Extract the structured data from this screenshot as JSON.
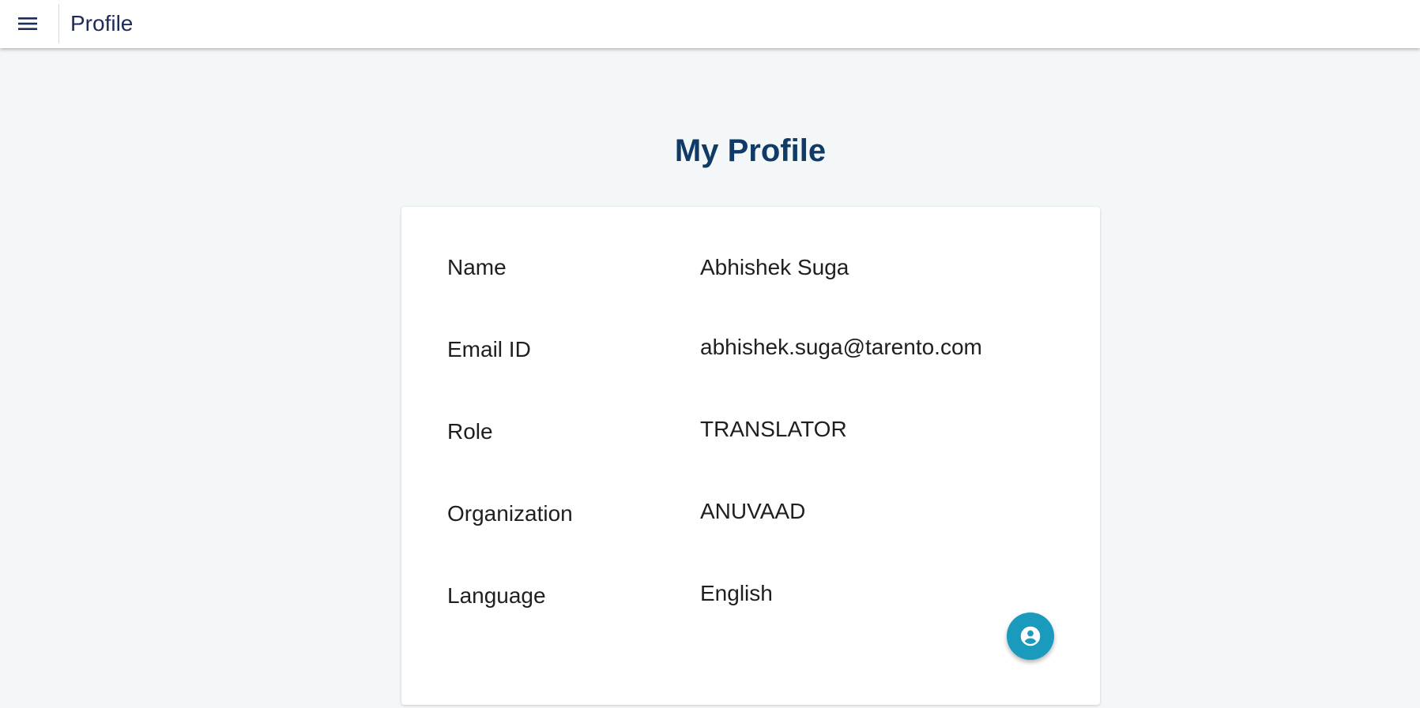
{
  "appbar": {
    "title": "Profile",
    "menu_icon": "menu-icon"
  },
  "page": {
    "title": "My Profile"
  },
  "profile": {
    "fields": [
      {
        "label": "Name",
        "value": "Abhishek Suga"
      },
      {
        "label": "Email ID",
        "value": "abhishek.suga@tarento.com"
      },
      {
        "label": "Role",
        "value": "TRANSLATOR"
      },
      {
        "label": "Organization",
        "value": "ANUVAAD"
      },
      {
        "label": "Language",
        "value": "English"
      }
    ]
  },
  "fab": {
    "icon": "account-circle-icon",
    "color": "#1a9bbd"
  },
  "colors": {
    "background": "#f4f7f8",
    "title": "#0f3b66",
    "appbar_title": "#1c2b5a"
  }
}
